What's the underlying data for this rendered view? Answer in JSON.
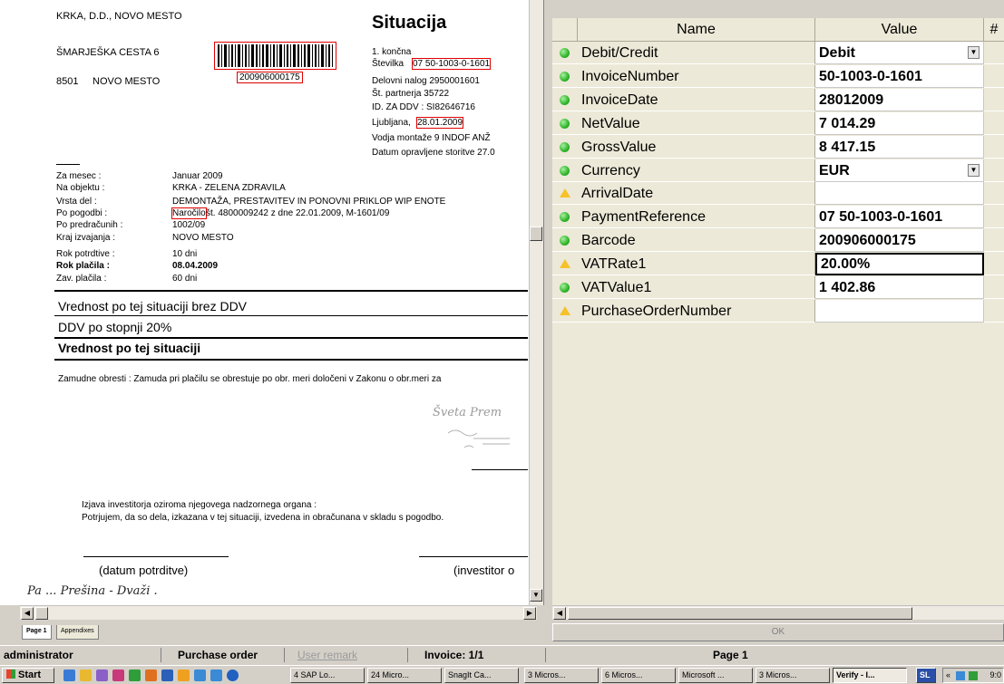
{
  "document": {
    "company": "KRKA, D.D., NOVO MESTO",
    "street": "ŠMARJEŠKA CESTA 6",
    "postcode": "8501",
    "city": "NOVO MESTO",
    "barcode_number": "200906000175",
    "doc_title": "Situacija",
    "header_lines": [
      "1. končna",
      "Številka",
      "07 50-1003-0-1601",
      "Delovni nalog 2950001601",
      "Št. partnerja 35722",
      "ID. ZA DDV : SI82646716",
      "Ljubljana,",
      "28.01.2009",
      "Vodja montaže  9 INDOF ANŽ",
      "Datum opravljene storitve 27.0"
    ],
    "details": [
      {
        "label": "Za mesec :",
        "value": "Januar 2009"
      },
      {
        "label": "Na objektu :",
        "value": "KRKA - ZELENA ZDRAVILA"
      },
      {
        "label": "Vrsta del :",
        "value": "DEMONTAŽA, PRESTAVITEV IN PONOVNI PRIKLOP WIP ENOTE"
      },
      {
        "label": "Po pogodbi :",
        "value": "Naročilo",
        "value2": " št. 4800009242 z dne 22.01.2009, M-1601/09"
      },
      {
        "label": "Po predračunih :",
        "value": "1002/09"
      },
      {
        "label": "Kraj izvajanja :",
        "value": "NOVO MESTO"
      },
      {
        "label": "Rok potrdtive :",
        "value": "10 dni"
      },
      {
        "label": "Rok plačila  :",
        "value": "08.04.2009"
      },
      {
        "label": "Zav. plačila  :",
        "value": "60 dni"
      }
    ],
    "value_no_vat": "Vrednost po tej situaciji brez DDV",
    "vat_rate_line": "DDV po stopnji 20%",
    "value_total": "Vrednost po tej situaciji",
    "interest_note": "Zamudne obresti :  Zamuda pri plačilu se obrestuje po obr. meri določeni v Zakonu o obr.meri za",
    "stamp_text": "Šveta  Prem",
    "investor_stmt_1": "Izjava investitorja oziroma njegovega nadzornega organa :",
    "investor_stmt_2": "Potrjujem, da so dela, izkazana v tej situaciji, izvedena in obračunana v skladu s pogodbo.",
    "sig_date": "(datum potrditve)",
    "sig_investor": "(investitor o",
    "handwriting": "Pa  ...  Prešina  - Dvaži ."
  },
  "page_tabs": [
    "Page 1",
    "Appendixes"
  ],
  "grid": {
    "headers": [
      "Name",
      "Value",
      "#"
    ],
    "rows": [
      {
        "status": "ok",
        "name": "Debit/Credit",
        "value": "Debit",
        "dropdown": true
      },
      {
        "status": "ok",
        "name": "InvoiceNumber",
        "value": "50-1003-0-1601"
      },
      {
        "status": "ok",
        "name": "InvoiceDate",
        "value": "28012009"
      },
      {
        "status": "ok",
        "name": "NetValue",
        "value": "7 014.29"
      },
      {
        "status": "ok",
        "name": "GrossValue",
        "value": "8 417.15"
      },
      {
        "status": "ok",
        "name": "Currency",
        "value": "EUR",
        "dropdown": true
      },
      {
        "status": "warn",
        "name": "ArrivalDate",
        "value": ""
      },
      {
        "status": "ok",
        "name": "PaymentReference",
        "value": "07 50-1003-0-1601"
      },
      {
        "status": "ok",
        "name": "Barcode",
        "value": "200906000175"
      },
      {
        "status": "warn",
        "name": "VATRate1",
        "value": "20.00%",
        "selected": true
      },
      {
        "status": "ok",
        "name": "VATValue1",
        "value": "1 402.86"
      },
      {
        "status": "warn",
        "name": "PurchaseOrderNumber",
        "value": ""
      }
    ],
    "ok_label": "OK"
  },
  "statusbar": {
    "user": "administrator",
    "doc_type": "Purchase order",
    "remark": "User remark",
    "invoice": "Invoice: 1/1",
    "page": "Page 1"
  },
  "taskbar": {
    "start": "Start",
    "items": [
      {
        "label": "4 SAP Lo...",
        "active": false
      },
      {
        "label": "24 Micro...",
        "active": false
      },
      {
        "label": "SnagIt Ca...",
        "active": false
      },
      {
        "label": "3 Micros...",
        "active": false
      },
      {
        "label": "6 Micros...",
        "active": false
      },
      {
        "label": "Microsoft ...",
        "active": false
      },
      {
        "label": "3 Micros...",
        "active": false
      },
      {
        "label": "Verify - I...",
        "active": true
      }
    ],
    "lang": "SL",
    "clock": "9:0"
  },
  "colors": {
    "ok": "#2fb52a",
    "warn": "#f6c12a",
    "highlight": "#e00000"
  }
}
